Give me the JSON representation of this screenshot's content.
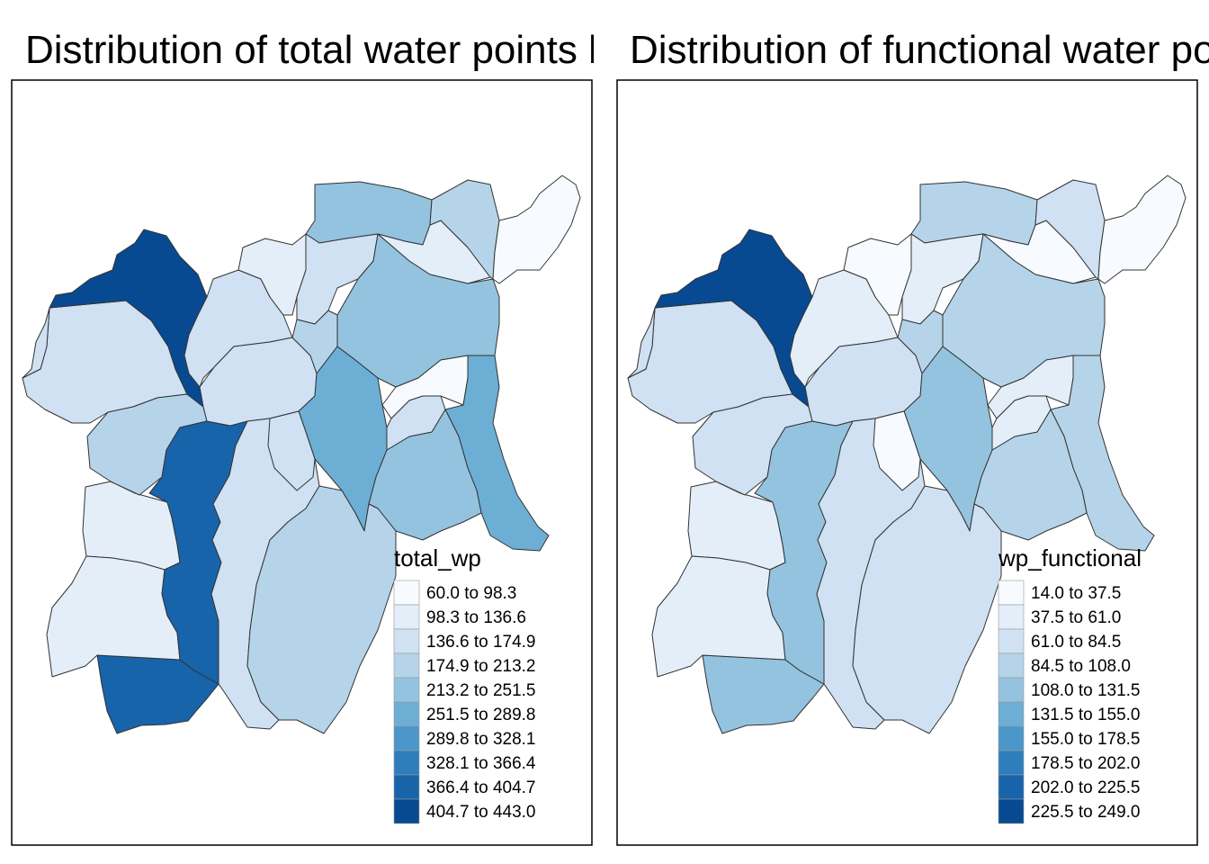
{
  "panels": [
    {
      "title": "Distribution of total  water points by LGA",
      "legend": {
        "title": "total_wp",
        "classes": [
          "60.0 to 98.3",
          "98.3 to 136.6",
          "136.6 to 174.9",
          "174.9 to 213.2",
          "213.2 to 251.5",
          "251.5 to 289.8",
          "289.8 to 328.1",
          "328.1 to 366.4",
          "366.4 to 404.7",
          "404.7 to 443.0"
        ]
      }
    },
    {
      "title": "Distribution of functional water points by LGA",
      "legend": {
        "title": "wp_functional",
        "classes": [
          "14.0 to 37.5",
          "37.5 to 61.0",
          "61.0 to 84.5",
          "84.5 to 108.0",
          "108.0 to 131.5",
          "131.5 to 155.0",
          "155.0 to 178.5",
          "178.5 to 202.0",
          "202.0 to 225.5",
          "225.5 to 249.0"
        ]
      }
    }
  ],
  "palette": [
    "#f7fbff",
    "#e3eef9",
    "#cfe1f2",
    "#b5d4e9",
    "#93c3df",
    "#6daed5",
    "#4b97c9",
    "#2f7ebc",
    "#1764ab",
    "#084a91"
  ],
  "colors": {
    "border": "#000000",
    "region_outline": "#333333",
    "background": "#ffffff"
  }
}
